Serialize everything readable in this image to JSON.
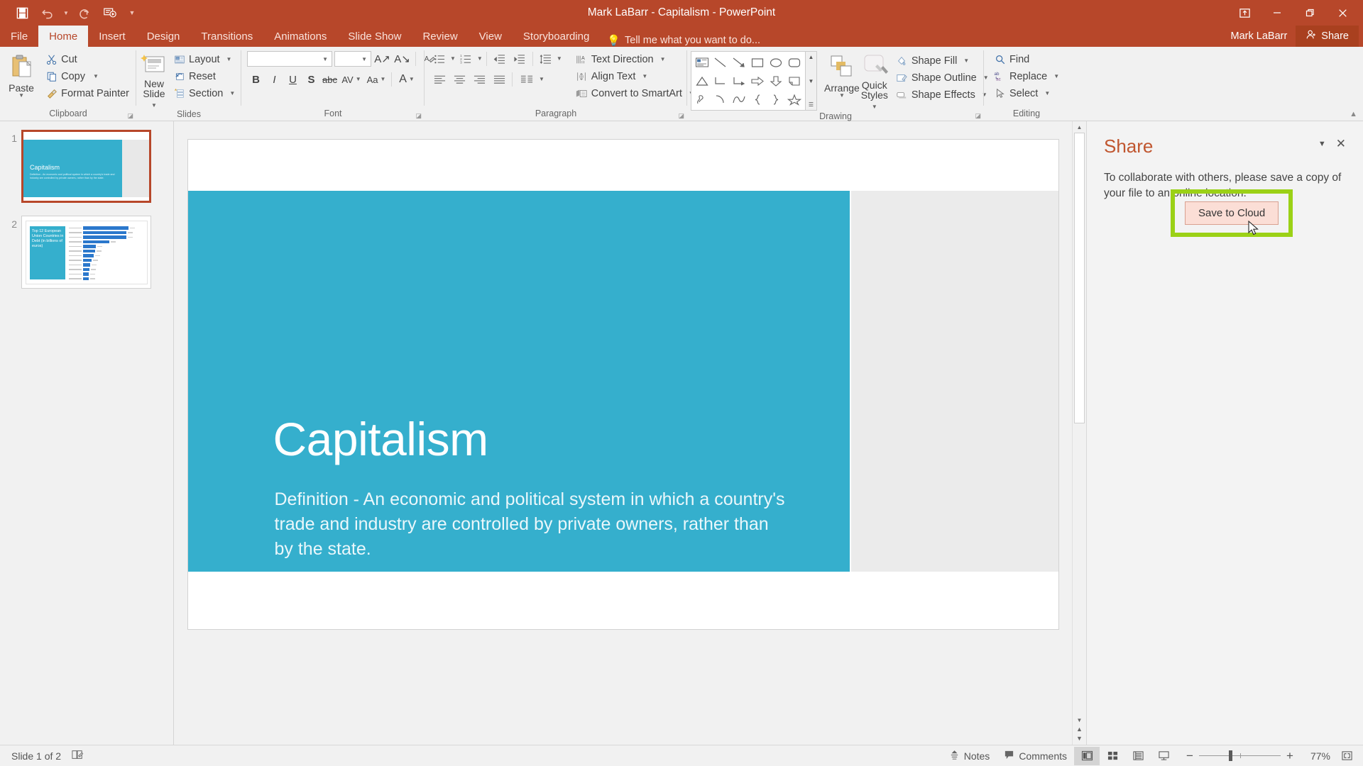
{
  "titlebar": {
    "document_title": "Mark LaBarr - Capitalism - PowerPoint",
    "qat": [
      {
        "name": "save-icon",
        "label": "Save"
      },
      {
        "name": "undo-icon",
        "label": "Undo"
      },
      {
        "name": "undo-dropdown-icon",
        "label": "Undo options"
      },
      {
        "name": "redo-icon",
        "label": "Redo"
      },
      {
        "name": "start-presentation-icon",
        "label": "Start From Beginning"
      },
      {
        "name": "customize-qat-icon",
        "label": "Customize Quick Access Toolbar"
      }
    ],
    "window_controls": [
      {
        "name": "ribbon-display-options-icon",
        "label": "Ribbon Display Options"
      },
      {
        "name": "minimize-icon",
        "label": "Minimize"
      },
      {
        "name": "restore-icon",
        "label": "Restore Down"
      },
      {
        "name": "close-icon",
        "label": "Close"
      }
    ]
  },
  "tabs": {
    "items": [
      {
        "label": "File",
        "id": "file"
      },
      {
        "label": "Home",
        "id": "home"
      },
      {
        "label": "Insert",
        "id": "insert"
      },
      {
        "label": "Design",
        "id": "design"
      },
      {
        "label": "Transitions",
        "id": "transitions"
      },
      {
        "label": "Animations",
        "id": "animations"
      },
      {
        "label": "Slide Show",
        "id": "slide-show"
      },
      {
        "label": "Review",
        "id": "review"
      },
      {
        "label": "View",
        "id": "view"
      },
      {
        "label": "Storyboarding",
        "id": "storyboarding"
      }
    ],
    "active": "Home",
    "tell_me": "Tell me what you want to do...",
    "account_name": "Mark LaBarr",
    "share_label": "Share"
  },
  "ribbon": {
    "clipboard": {
      "group_label": "Clipboard",
      "paste": "Paste",
      "cut": "Cut",
      "copy": "Copy",
      "format_painter": "Format Painter"
    },
    "slides": {
      "group_label": "Slides",
      "new_slide_line1": "New",
      "new_slide_line2": "Slide",
      "layout": "Layout",
      "reset": "Reset",
      "section": "Section"
    },
    "font": {
      "group_label": "Font",
      "font_name": "",
      "font_size": "",
      "buttons": [
        "Bold",
        "Italic",
        "Underline",
        "Text Shadow",
        "Strikethrough",
        "Character Spacing",
        "Change Case",
        "Font Color"
      ]
    },
    "paragraph": {
      "group_label": "Paragraph",
      "text_direction": "Text Direction",
      "align_text": "Align Text",
      "convert_to_smartart": "Convert to SmartArt"
    },
    "drawing": {
      "group_label": "Drawing",
      "arrange": "Arrange",
      "quick_styles_line1": "Quick",
      "quick_styles_line2": "Styles",
      "shape_fill": "Shape Fill",
      "shape_outline": "Shape Outline",
      "shape_effects": "Shape Effects"
    },
    "editing": {
      "group_label": "Editing",
      "find": "Find",
      "replace": "Replace",
      "select": "Select"
    },
    "collapse_label": "Collapse the Ribbon"
  },
  "thumbnails": [
    {
      "number": "1",
      "selected": true,
      "title": "Capitalism",
      "body": "Definition - An economic and political system in which a country's trade and industry are controlled by private owners, rather than by the state."
    },
    {
      "number": "2",
      "selected": false,
      "title": "Top 12 European Union Countries in Debt (in billions of euros)"
    }
  ],
  "slide": {
    "title": "Capitalism",
    "body": "Definition - An economic and political system in which a country's trade and industry are controlled by private owners, rather than by the state.",
    "accent_color": "#35afcd"
  },
  "share_pane": {
    "title": "Share",
    "description": "To collaborate with others, please save a copy of your file to an online location.",
    "button_label": "Save to Cloud",
    "button_accesskey": "S",
    "highlight_color": "#9bd116",
    "collapse_label": "Pane Options",
    "close_label": "Close"
  },
  "statusbar": {
    "slide_counter": "Slide 1 of 2",
    "notes": "Notes",
    "comments": "Comments",
    "zoom_level": "77%",
    "views": [
      {
        "name": "normal-view-button",
        "label": "Normal",
        "active": true
      },
      {
        "name": "slide-sorter-button",
        "label": "Slide Sorter",
        "active": false
      },
      {
        "name": "reading-view-button",
        "label": "Reading View",
        "active": false
      },
      {
        "name": "slide-show-button",
        "label": "Slide Show",
        "active": false
      }
    ],
    "fit_label": "Fit slide to current window"
  },
  "chart_data": {
    "type": "bar",
    "orientation": "horizontal",
    "title": "Top 12 European Union Countries in Debt (in billions of euros)",
    "categories": [
      "C1",
      "C2",
      "C3",
      "C4",
      "C5",
      "C6",
      "C7",
      "C8",
      "C9",
      "C10",
      "C11",
      "C12"
    ],
    "values": [
      100,
      96,
      96,
      58,
      28,
      26,
      24,
      18,
      16,
      14,
      13,
      12
    ],
    "xlabel": "",
    "ylabel": "",
    "series_color": "#2b78cc"
  }
}
